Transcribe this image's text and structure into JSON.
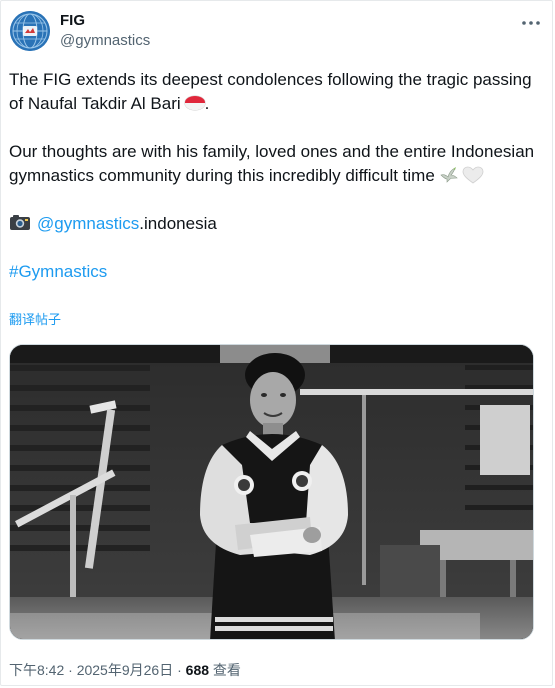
{
  "account": {
    "display_name": "FIG",
    "handle": "@gymnastics",
    "avatar_icon": "fig-globe-logo-icon",
    "avatar_color": "#2a73b7"
  },
  "menu_icon": "more-horizontal-icon",
  "tweet": {
    "p1_text": "The FIG extends its deepest condolences following the tragic passing of Naufal Takdir Al Bari",
    "p1_end": ".",
    "p2_text": "Our thoughts are with his family, loved ones and the entire Indonesian gymnastics community during this incredibly difficult time",
    "credit_mention": "@gymnastics",
    "credit_suffix": ".indonesia",
    "hashtag": "#Gymnastics",
    "emoji": [
      "indonesia-flag-icon",
      "dove-icon",
      "white-heart-icon",
      "camera-icon"
    ]
  },
  "translate_label": "翻译帖子",
  "media": {
    "type": "photo",
    "style": "black-and-white"
  },
  "meta": {
    "time": "下午8:42",
    "date": "2025年9月26日",
    "views_count": "688",
    "views_label": "查看"
  },
  "colors": {
    "link": "#1d9bf0",
    "secondary_text": "#536471",
    "primary_text": "#0f1419"
  }
}
